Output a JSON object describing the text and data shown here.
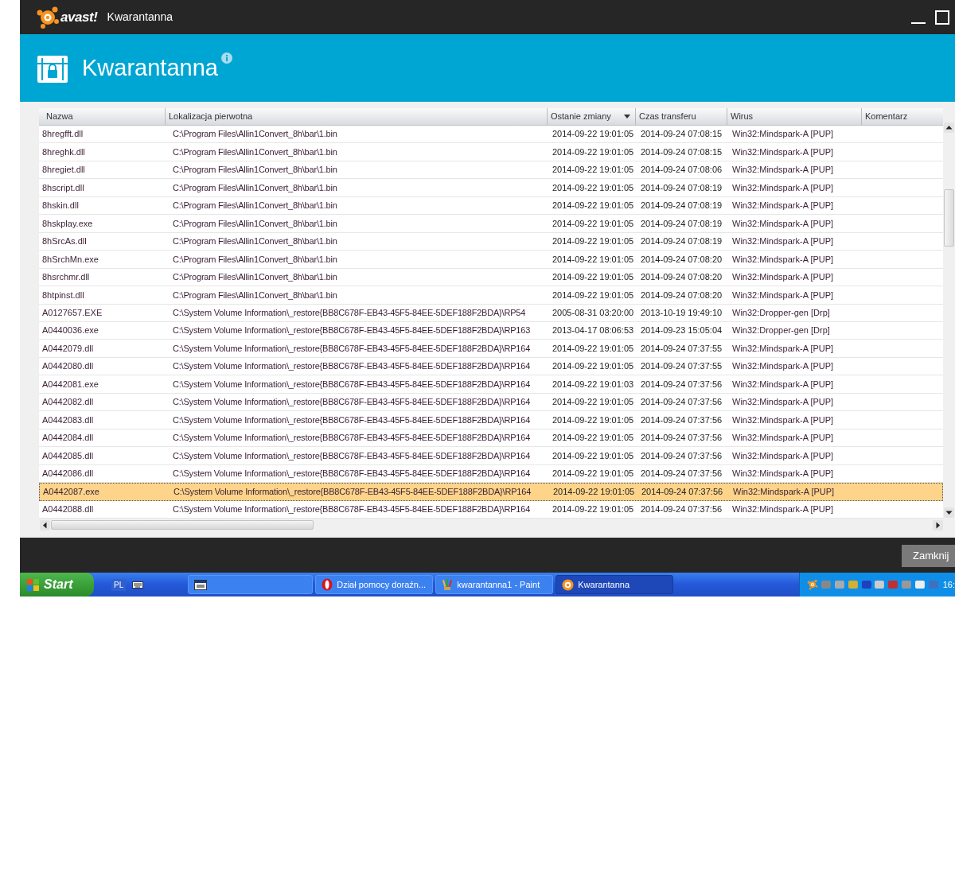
{
  "window": {
    "logo_text": "avast!",
    "title": "Kwarantanna"
  },
  "header": {
    "title": "Kwarantanna"
  },
  "table": {
    "columns": [
      {
        "label": "Nazwa",
        "sorted": false
      },
      {
        "label": "Lokalizacja pierwotna",
        "sorted": false
      },
      {
        "label": "Ostanie zmiany",
        "sorted": true
      },
      {
        "label": "Czas transferu",
        "sorted": false
      },
      {
        "label": "Wirus",
        "sorted": false
      },
      {
        "label": "Komentarz",
        "sorted": false
      }
    ],
    "rows": [
      {
        "name": "8hregfft.dll",
        "location": "C:\\Program Files\\Allin1Convert_8h\\bar\\1.bin",
        "modified": "2014-09-22 19:01:05",
        "transferred": "2014-09-24 07:08:15",
        "virus": "Win32:Mindspark-A [PUP]",
        "selected": false
      },
      {
        "name": "8hreghk.dll",
        "location": "C:\\Program Files\\Allin1Convert_8h\\bar\\1.bin",
        "modified": "2014-09-22 19:01:05",
        "transferred": "2014-09-24 07:08:15",
        "virus": "Win32:Mindspark-A [PUP]",
        "selected": false
      },
      {
        "name": "8hregiet.dll",
        "location": "C:\\Program Files\\Allin1Convert_8h\\bar\\1.bin",
        "modified": "2014-09-22 19:01:05",
        "transferred": "2014-09-24 07:08:06",
        "virus": "Win32:Mindspark-A [PUP]",
        "selected": false
      },
      {
        "name": "8hscript.dll",
        "location": "C:\\Program Files\\Allin1Convert_8h\\bar\\1.bin",
        "modified": "2014-09-22 19:01:05",
        "transferred": "2014-09-24 07:08:19",
        "virus": "Win32:Mindspark-A [PUP]",
        "selected": false
      },
      {
        "name": "8hskin.dll",
        "location": "C:\\Program Files\\Allin1Convert_8h\\bar\\1.bin",
        "modified": "2014-09-22 19:01:05",
        "transferred": "2014-09-24 07:08:19",
        "virus": "Win32:Mindspark-A [PUP]",
        "selected": false
      },
      {
        "name": "8hskplay.exe",
        "location": "C:\\Program Files\\Allin1Convert_8h\\bar\\1.bin",
        "modified": "2014-09-22 19:01:05",
        "transferred": "2014-09-24 07:08:19",
        "virus": "Win32:Mindspark-A [PUP]",
        "selected": false
      },
      {
        "name": "8hSrcAs.dll",
        "location": "C:\\Program Files\\Allin1Convert_8h\\bar\\1.bin",
        "modified": "2014-09-22 19:01:05",
        "transferred": "2014-09-24 07:08:19",
        "virus": "Win32:Mindspark-A [PUP]",
        "selected": false
      },
      {
        "name": "8hSrchMn.exe",
        "location": "C:\\Program Files\\Allin1Convert_8h\\bar\\1.bin",
        "modified": "2014-09-22 19:01:05",
        "transferred": "2014-09-24 07:08:20",
        "virus": "Win32:Mindspark-A [PUP]",
        "selected": false
      },
      {
        "name": "8hsrchmr.dll",
        "location": "C:\\Program Files\\Allin1Convert_8h\\bar\\1.bin",
        "modified": "2014-09-22 19:01:05",
        "transferred": "2014-09-24 07:08:20",
        "virus": "Win32:Mindspark-A [PUP]",
        "selected": false
      },
      {
        "name": "8htpinst.dll",
        "location": "C:\\Program Files\\Allin1Convert_8h\\bar\\1.bin",
        "modified": "2014-09-22 19:01:05",
        "transferred": "2014-09-24 07:08:20",
        "virus": "Win32:Mindspark-A [PUP]",
        "selected": false
      },
      {
        "name": "A0127657.EXE",
        "location": "C:\\System Volume Information\\_restore{BB8C678F-EB43-45F5-84EE-5DEF188F2BDA}\\RP54",
        "modified": "2005-08-31 03:20:00",
        "transferred": "2013-10-19 19:49:10",
        "virus": "Win32:Dropper-gen [Drp]",
        "selected": false
      },
      {
        "name": "A0440036.exe",
        "location": "C:\\System Volume Information\\_restore{BB8C678F-EB43-45F5-84EE-5DEF188F2BDA}\\RP163",
        "modified": "2013-04-17 08:06:53",
        "transferred": "2014-09-23 15:05:04",
        "virus": "Win32:Dropper-gen [Drp]",
        "selected": false
      },
      {
        "name": "A0442079.dll",
        "location": "C:\\System Volume Information\\_restore{BB8C678F-EB43-45F5-84EE-5DEF188F2BDA}\\RP164",
        "modified": "2014-09-22 19:01:05",
        "transferred": "2014-09-24 07:37:55",
        "virus": "Win32:Mindspark-A [PUP]",
        "selected": false
      },
      {
        "name": "A0442080.dll",
        "location": "C:\\System Volume Information\\_restore{BB8C678F-EB43-45F5-84EE-5DEF188F2BDA}\\RP164",
        "modified": "2014-09-22 19:01:05",
        "transferred": "2014-09-24 07:37:55",
        "virus": "Win32:Mindspark-A [PUP]",
        "selected": false
      },
      {
        "name": "A0442081.exe",
        "location": "C:\\System Volume Information\\_restore{BB8C678F-EB43-45F5-84EE-5DEF188F2BDA}\\RP164",
        "modified": "2014-09-22 19:01:03",
        "transferred": "2014-09-24 07:37:56",
        "virus": "Win32:Mindspark-A [PUP]",
        "selected": false
      },
      {
        "name": "A0442082.dll",
        "location": "C:\\System Volume Information\\_restore{BB8C678F-EB43-45F5-84EE-5DEF188F2BDA}\\RP164",
        "modified": "2014-09-22 19:01:05",
        "transferred": "2014-09-24 07:37:56",
        "virus": "Win32:Mindspark-A [PUP]",
        "selected": false
      },
      {
        "name": "A0442083.dll",
        "location": "C:\\System Volume Information\\_restore{BB8C678F-EB43-45F5-84EE-5DEF188F2BDA}\\RP164",
        "modified": "2014-09-22 19:01:05",
        "transferred": "2014-09-24 07:37:56",
        "virus": "Win32:Mindspark-A [PUP]",
        "selected": false
      },
      {
        "name": "A0442084.dll",
        "location": "C:\\System Volume Information\\_restore{BB8C678F-EB43-45F5-84EE-5DEF188F2BDA}\\RP164",
        "modified": "2014-09-22 19:01:05",
        "transferred": "2014-09-24 07:37:56",
        "virus": "Win32:Mindspark-A [PUP]",
        "selected": false
      },
      {
        "name": "A0442085.dll",
        "location": "C:\\System Volume Information\\_restore{BB8C678F-EB43-45F5-84EE-5DEF188F2BDA}\\RP164",
        "modified": "2014-09-22 19:01:05",
        "transferred": "2014-09-24 07:37:56",
        "virus": "Win32:Mindspark-A [PUP]",
        "selected": false
      },
      {
        "name": "A0442086.dll",
        "location": "C:\\System Volume Information\\_restore{BB8C678F-EB43-45F5-84EE-5DEF188F2BDA}\\RP164",
        "modified": "2014-09-22 19:01:05",
        "transferred": "2014-09-24 07:37:56",
        "virus": "Win32:Mindspark-A [PUP]",
        "selected": false
      },
      {
        "name": "A0442087.exe",
        "location": "C:\\System Volume Information\\_restore{BB8C678F-EB43-45F5-84EE-5DEF188F2BDA}\\RP164",
        "modified": "2014-09-22 19:01:05",
        "transferred": "2014-09-24 07:37:56",
        "virus": "Win32:Mindspark-A [PUP]",
        "selected": true
      },
      {
        "name": "A0442088.dll",
        "location": "C:\\System Volume Information\\_restore{BB8C678F-EB43-45F5-84EE-5DEF188F2BDA}\\RP164",
        "modified": "2014-09-22 19:01:05",
        "transferred": "2014-09-24 07:37:56",
        "virus": "Win32:Mindspark-A [PUP]",
        "selected": false
      }
    ]
  },
  "footer": {
    "close_button": "Zamknij"
  },
  "taskbar": {
    "start": "Start",
    "language": "PL",
    "tasks": [
      {
        "kind": "gmer",
        "selected": false
      },
      {
        "kind": "opera",
        "label": "Dział pomocy doraźn...",
        "selected": false
      },
      {
        "kind": "paint",
        "label": "kwarantanna1 - Paint",
        "selected": false
      },
      {
        "kind": "avast",
        "label": "Kwarantanna",
        "selected": true
      }
    ],
    "clock": "16:"
  }
}
